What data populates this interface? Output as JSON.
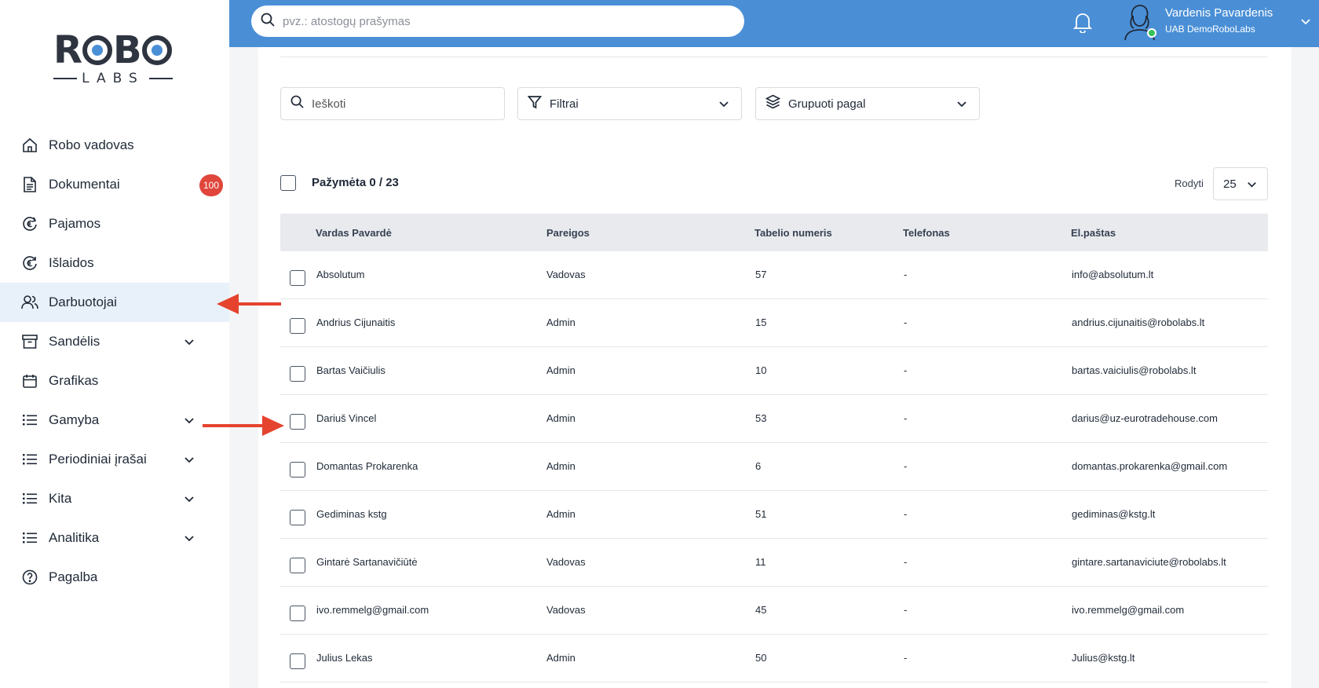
{
  "logo": {
    "top": "R",
    "top_rest": "B",
    "bottom": "LABS"
  },
  "sidebar": {
    "items": [
      {
        "label": "Robo vadovas",
        "icon": "home-icon"
      },
      {
        "label": "Dokumentai",
        "icon": "document-icon",
        "badge": "100"
      },
      {
        "label": "Pajamos",
        "icon": "euro-income-icon"
      },
      {
        "label": "Išlaidos",
        "icon": "euro-expense-icon"
      },
      {
        "label": "Darbuotojai",
        "icon": "users-icon",
        "active": true
      },
      {
        "label": "Sandėlis",
        "icon": "archive-icon",
        "expandable": true
      },
      {
        "label": "Grafikas",
        "icon": "calendar-icon"
      },
      {
        "label": "Gamyba",
        "icon": "list-icon",
        "expandable": true
      },
      {
        "label": "Periodiniai įrašai",
        "icon": "list-icon",
        "expandable": true
      },
      {
        "label": "Kita",
        "icon": "list-icon",
        "expandable": true
      },
      {
        "label": "Analitika",
        "icon": "list-icon",
        "expandable": true
      },
      {
        "label": "Pagalba",
        "icon": "help-icon"
      }
    ]
  },
  "topbar": {
    "search_placeholder": "pvz.: atostogų prašymas",
    "user_name": "Vardenis Pavardenis",
    "user_company": "UAB DemoRoboLabs"
  },
  "toolbar": {
    "search_placeholder": "Ieškoti",
    "filters_label": "Filtrai",
    "group_label": "Grupuoti pagal"
  },
  "selection": {
    "label": "Pažymėta 0 / 23",
    "show_label": "Rodyti",
    "page_size": "25"
  },
  "table": {
    "columns": [
      "Vardas Pavardė",
      "Pareigos",
      "Tabelio numeris",
      "Telefonas",
      "El.paštas"
    ],
    "rows": [
      [
        "Absolutum",
        "Vadovas",
        "57",
        "-",
        "info@absolutum.lt"
      ],
      [
        "Andrius Cijunaitis",
        "Admin",
        "15",
        "-",
        "andrius.cijunaitis@robolabs.lt"
      ],
      [
        "Bartas Vaičiulis",
        "Admin",
        "10",
        "-",
        "bartas.vaiciulis@robolabs.lt"
      ],
      [
        "Dariuš Vincel",
        "Admin",
        "53",
        "-",
        "darius@uz-eurotradehouse.com"
      ],
      [
        "Domantas Prokarenka",
        "Admin",
        "6",
        "-",
        "domantas.prokarenka@gmail.com"
      ],
      [
        "Gediminas kstg",
        "Admin",
        "51",
        "-",
        "gediminas@kstg.lt"
      ],
      [
        "Gintarė Sartanavičiūtė",
        "Vadovas",
        "11",
        "-",
        "gintare.sartanaviciute@robolabs.lt"
      ],
      [
        "ivo.remmelg@gmail.com",
        "Vadovas",
        "45",
        "-",
        "ivo.remmelg@gmail.com"
      ],
      [
        "Julius Lekas",
        "Admin",
        "50",
        "-",
        "Julius@kstg.lt"
      ]
    ]
  },
  "colors": {
    "accent": "#4a8fd6",
    "badge": "#e0463b",
    "arrow": "#e5432e",
    "active_bg": "#e8f1fa"
  }
}
